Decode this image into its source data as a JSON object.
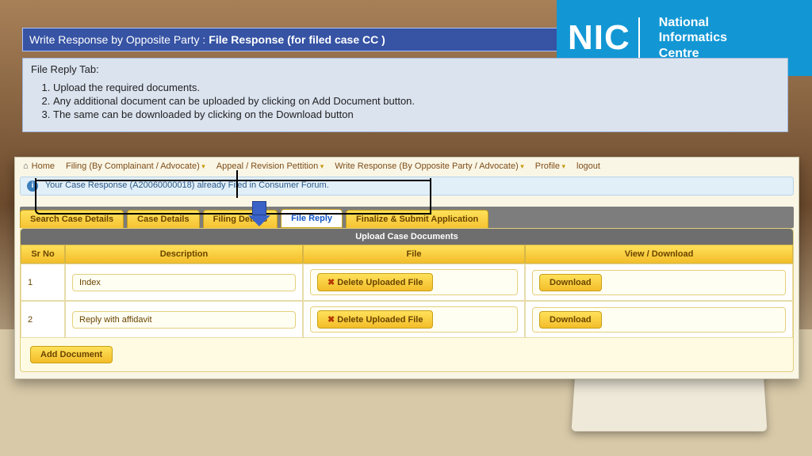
{
  "title": {
    "light": "Write Response by Opposite Party :",
    "bold": "File Response (for filed case CC )"
  },
  "logo": {
    "abbr": "NIC",
    "line1": "National",
    "line2": "Informatics",
    "line3": "Centre"
  },
  "instructions": {
    "heading": "File Reply Tab:",
    "items": [
      "Upload the required documents.",
      "Any additional document can be uploaded by clicking on Add Document button.",
      "The same can be downloaded by clicking on the Download button"
    ]
  },
  "menu": {
    "home": "Home",
    "filing": "Filing (By Complainant / Advocate)",
    "appeal": "Appeal / Revision Pettition",
    "write": "Write Response (By Opposite Party / Advocate)",
    "profile": "Profile",
    "logout": "logout"
  },
  "alert": "Your Case Response (A20060000018) already Filed in Consumer Forum.",
  "tabs": {
    "search": "Search Case Details",
    "case": "Case Details",
    "filing": "Filing Details",
    "reply": "File Reply",
    "finalize": "Finalize & Submit Application"
  },
  "table": {
    "title": "Upload Case Documents",
    "cols": {
      "sr": "Sr No",
      "desc": "Description",
      "file": "File",
      "view": "View / Download"
    },
    "rows": [
      {
        "sr": "1",
        "desc": "Index",
        "fileBtn": "Delete Uploaded File",
        "viewBtn": "Download"
      },
      {
        "sr": "2",
        "desc": "Reply with affidavit",
        "fileBtn": "Delete Uploaded File",
        "viewBtn": "Download"
      }
    ],
    "add": "Add Document"
  }
}
